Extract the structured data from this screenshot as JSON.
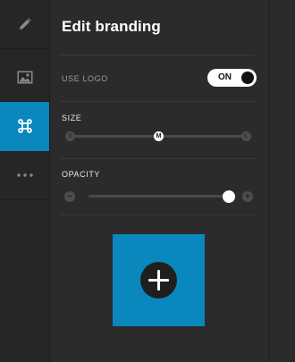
{
  "panel": {
    "title": "Edit branding"
  },
  "rail": {
    "items": [
      {
        "icon": "pencil-icon",
        "active": false
      },
      {
        "icon": "image-icon",
        "active": false
      },
      {
        "icon": "command-icon",
        "active": true
      },
      {
        "icon": "more-icon",
        "active": false
      }
    ]
  },
  "use_logo": {
    "label": "USE LOGO",
    "toggle_label": "ON",
    "state": true
  },
  "size": {
    "label": "SIZE",
    "options": [
      "S",
      "M",
      "L"
    ],
    "selected": "M"
  },
  "opacity": {
    "label": "OPACITY",
    "decrease_symbol": "−",
    "increase_symbol": "+",
    "value": 1.0
  },
  "colors": {
    "accent": "#0a87bd",
    "background": "#2b2b2b",
    "rail": "#262626"
  }
}
